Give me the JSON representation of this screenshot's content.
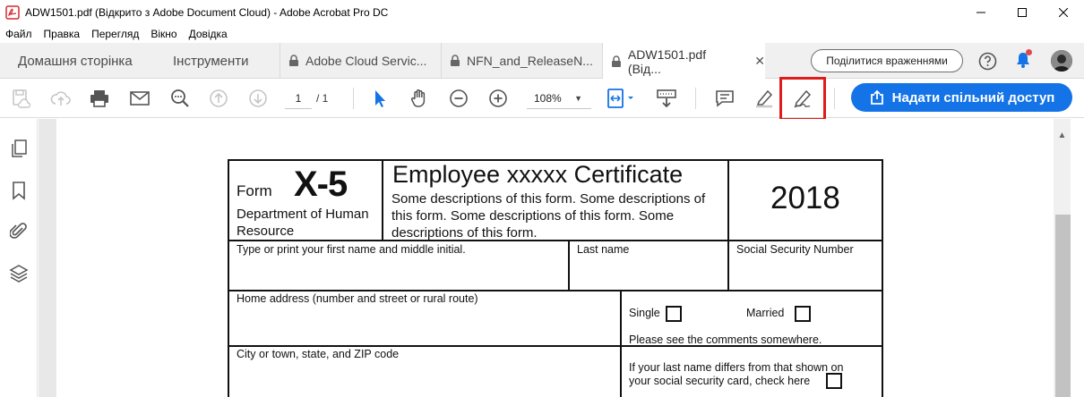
{
  "window": {
    "title": "ADW1501.pdf (Відкрито з Adobe Document Cloud) - Adobe Acrobat Pro DC",
    "controls": [
      "minimize",
      "maximize",
      "close"
    ]
  },
  "menu": [
    "Файл",
    "Правка",
    "Перегляд",
    "Вікно",
    "Довідка"
  ],
  "tabs": {
    "home": "Домашня сторінка",
    "tools": "Інструменти",
    "files": [
      {
        "label": "Adobe Cloud Servic...",
        "active": false
      },
      {
        "label": "NFN_and_ReleaseN...",
        "active": false
      },
      {
        "label": "ADW1501.pdf (Від...",
        "active": true
      }
    ],
    "close_glyph": "✕",
    "feedback": "Поділитися враженнями"
  },
  "toolbar": {
    "page_current": "1",
    "page_total": "/ 1",
    "zoom": "108%",
    "share_label": "Надати спільний доступ",
    "icons": [
      "save-cloud-icon",
      "upload-icon",
      "print-icon",
      "email-icon",
      "search-zoom-icon",
      "page-up-icon",
      "page-down-icon",
      "select-cursor-icon",
      "hand-icon",
      "zoom-out-icon",
      "zoom-in-icon",
      "fit-page-icon",
      "scroll-mode-icon",
      "comment-icon",
      "highlight-icon",
      "sign-pen-icon"
    ]
  },
  "left_rail": [
    "pages-icon",
    "bookmark-icon",
    "attachment-icon",
    "layers-icon"
  ],
  "form": {
    "form_word": "Form",
    "form_id": "X-5",
    "department": "Department of Human Resource",
    "title": "Employee xxxxx Certificate",
    "description": "Some descriptions of this form. Some descriptions of this form. Some descriptions of this form. Some descriptions of this form.",
    "year": "2018",
    "first_name_label": "Type or print your first name and middle initial.",
    "last_name_label": "Last name",
    "ssn_label": "Social Security Number",
    "home_address_label": "Home address (number and street or rural route)",
    "single_label": "Single",
    "married_label": "Married",
    "comments_note": "Please see the comments somewhere.",
    "city_label": "City or town, state, and ZIP code",
    "last_name_note_1": "If your last name differs from that shown on",
    "last_name_note_2": "your social security card, check here"
  },
  "colors": {
    "accent": "#1473e6",
    "highlight": "#e01b1b",
    "acrobat_red": "#d7282f"
  }
}
